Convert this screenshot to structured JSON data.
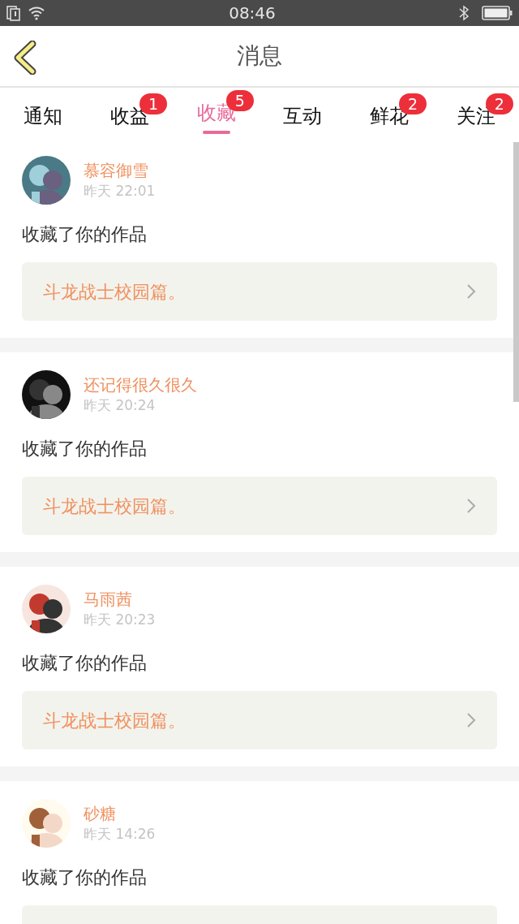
{
  "status_bar": {
    "time": "08:46"
  },
  "header": {
    "title": "消息"
  },
  "tabs": [
    {
      "label": "通知",
      "selected": false
    },
    {
      "label": "收益",
      "selected": false,
      "badge": "1"
    },
    {
      "label": "收藏",
      "selected": true,
      "badge": "5"
    },
    {
      "label": "互动",
      "selected": false
    },
    {
      "label": "鲜花",
      "selected": false,
      "badge": "2"
    },
    {
      "label": "关注",
      "selected": false,
      "badge": "2"
    }
  ],
  "messages": [
    {
      "user": "慕容御雪",
      "time": "昨天 22:01",
      "action": "收藏了你的作品",
      "work": "斗龙战士校园篇。"
    },
    {
      "user": "还记得很久很久",
      "time": "昨天 20:24",
      "action": "收藏了你的作品",
      "work": "斗龙战士校园篇。"
    },
    {
      "user": "马雨茜",
      "time": "昨天 20:23",
      "action": "收藏了你的作品",
      "work": "斗龙战士校园篇。"
    },
    {
      "user": "砂糖",
      "time": "昨天 14:26",
      "action": "收藏了你的作品"
    }
  ]
}
